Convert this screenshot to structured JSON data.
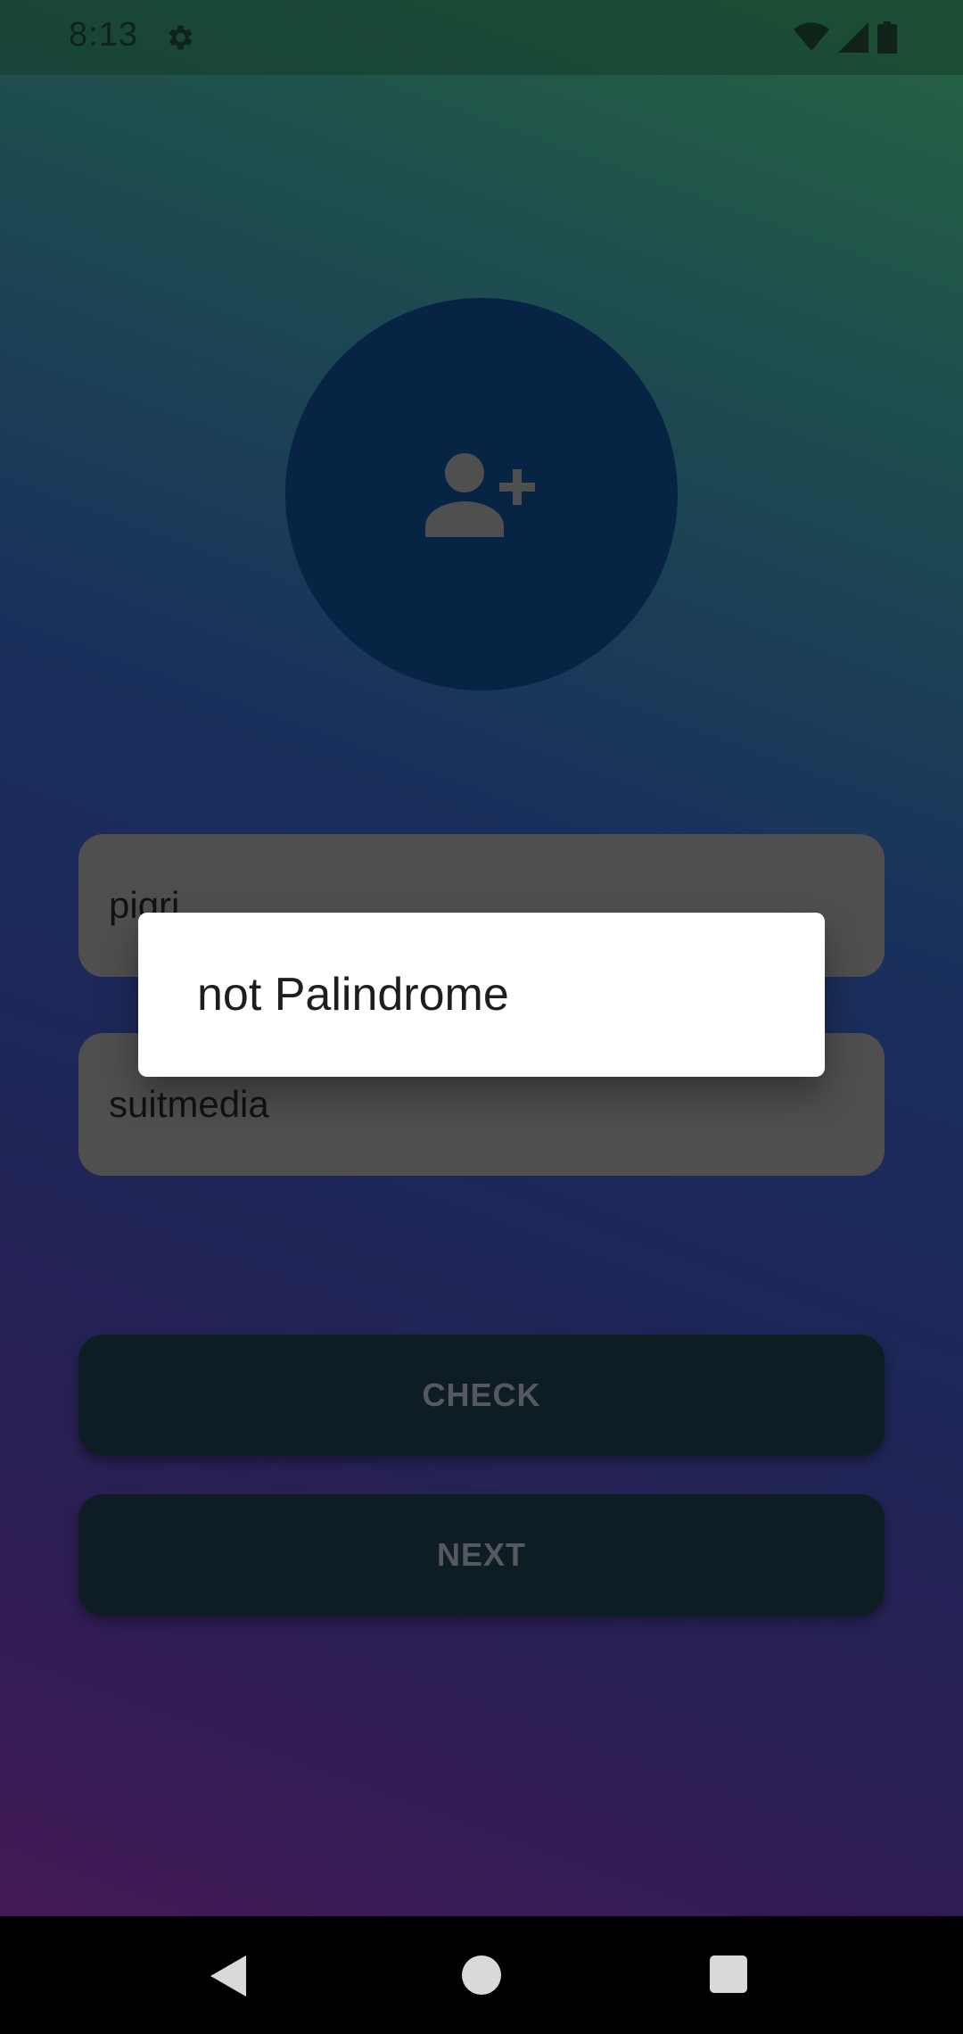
{
  "status_bar": {
    "time": "8:13",
    "icons": [
      "settings-icon",
      "wifi-icon",
      "signal-icon",
      "battery-icon"
    ]
  },
  "profile": {
    "icon": "add-person-icon"
  },
  "form": {
    "name_value": "pigri",
    "sentence_value": "suitmedia"
  },
  "buttons": {
    "check_label": "CHECK",
    "next_label": "NEXT"
  },
  "dialog": {
    "message": "not Palindrome"
  },
  "navigation": {
    "icons": [
      "back-icon",
      "home-icon",
      "recents-icon"
    ]
  },
  "colors": {
    "avatar_bg": "#0d3a6e",
    "button_bg": "#172e3b",
    "field_bg": "#808080"
  }
}
